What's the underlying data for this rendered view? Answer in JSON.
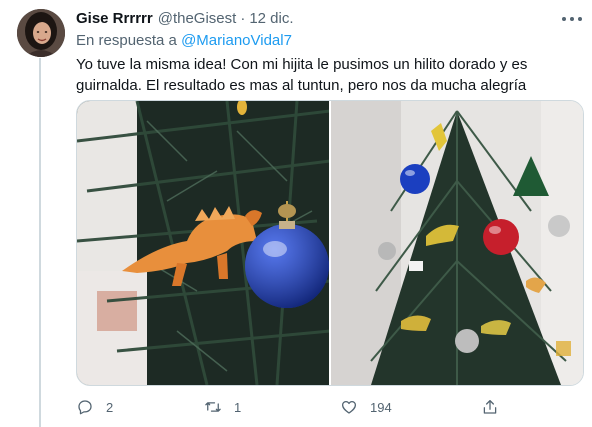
{
  "tweet": {
    "author_name": "Gise Rrrrrr",
    "author_handle": "@theGisest",
    "separator": "·",
    "timestamp": "12 dic.",
    "reply_prefix": "En respuesta a",
    "reply_mention": "@MarianoVidal7",
    "text_line1": "Yo tuve la misma idea! Con mi hijita le pusimos un hilito dorado y es",
    "text_line2": "guirnalda. El resultado es mas al tuntun, pero nos da mucha alegría",
    "icons": [
      "more-icon",
      "reply-icon",
      "retweet-icon",
      "like-icon",
      "share-icon"
    ]
  },
  "actions": {
    "reply_count": "2",
    "retweet_count": "1",
    "like_count": "194"
  },
  "colors": {
    "text": "#0f1419",
    "secondary": "#536471",
    "link": "#1d9bf0",
    "border": "#cfd9de"
  }
}
